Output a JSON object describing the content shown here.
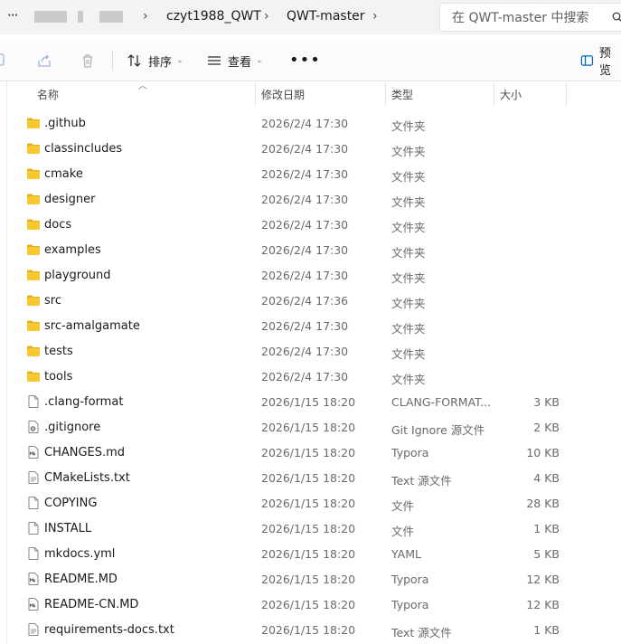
{
  "window": {
    "breadcrumbs": [
      "czyt1988_QWT",
      "QWT-master"
    ],
    "search_placeholder": "在 QWT-master 中搜索"
  },
  "toolbar": {
    "sort_label": "排序",
    "view_label": "查看",
    "more_label": "•••",
    "preview_label": "预览"
  },
  "columns": {
    "name": "名称",
    "modified": "修改日期",
    "type": "类型",
    "size": "大小"
  },
  "files": [
    {
      "name": ".github",
      "modified": "2026/2/4 17:30",
      "type": "文件夹",
      "size": "",
      "icon": "folder-icon"
    },
    {
      "name": "classincludes",
      "modified": "2026/2/4 17:30",
      "type": "文件夹",
      "size": "",
      "icon": "folder-icon"
    },
    {
      "name": "cmake",
      "modified": "2026/2/4 17:30",
      "type": "文件夹",
      "size": "",
      "icon": "folder-icon"
    },
    {
      "name": "designer",
      "modified": "2026/2/4 17:30",
      "type": "文件夹",
      "size": "",
      "icon": "folder-icon"
    },
    {
      "name": "docs",
      "modified": "2026/2/4 17:30",
      "type": "文件夹",
      "size": "",
      "icon": "folder-icon"
    },
    {
      "name": "examples",
      "modified": "2026/2/4 17:30",
      "type": "文件夹",
      "size": "",
      "icon": "folder-icon"
    },
    {
      "name": "playground",
      "modified": "2026/2/4 17:30",
      "type": "文件夹",
      "size": "",
      "icon": "folder-icon"
    },
    {
      "name": "src",
      "modified": "2026/2/4 17:36",
      "type": "文件夹",
      "size": "",
      "icon": "folder-icon"
    },
    {
      "name": "src-amalgamate",
      "modified": "2026/2/4 17:30",
      "type": "文件夹",
      "size": "",
      "icon": "folder-icon"
    },
    {
      "name": "tests",
      "modified": "2026/2/4 17:30",
      "type": "文件夹",
      "size": "",
      "icon": "folder-icon"
    },
    {
      "name": "tools",
      "modified": "2026/2/4 17:30",
      "type": "文件夹",
      "size": "",
      "icon": "folder-icon"
    },
    {
      "name": ".clang-format",
      "modified": "2026/1/15 18:20",
      "type": "CLANG-FORMAT...",
      "size": "3 KB",
      "icon": "file-icon"
    },
    {
      "name": ".gitignore",
      "modified": "2026/1/15 18:20",
      "type": "Git Ignore 源文件",
      "size": "2 KB",
      "icon": "settings-file-icon"
    },
    {
      "name": "CHANGES.md",
      "modified": "2026/1/15 18:20",
      "type": "Typora",
      "size": "10 KB",
      "icon": "markdown-file-icon"
    },
    {
      "name": "CMakeLists.txt",
      "modified": "2026/1/15 18:20",
      "type": "Text 源文件",
      "size": "4 KB",
      "icon": "text-file-icon"
    },
    {
      "name": "COPYING",
      "modified": "2026/1/15 18:20",
      "type": "文件",
      "size": "28 KB",
      "icon": "file-icon"
    },
    {
      "name": "INSTALL",
      "modified": "2026/1/15 18:20",
      "type": "文件",
      "size": "1 KB",
      "icon": "file-icon"
    },
    {
      "name": "mkdocs.yml",
      "modified": "2026/1/15 18:20",
      "type": "YAML",
      "size": "5 KB",
      "icon": "file-icon"
    },
    {
      "name": "README.MD",
      "modified": "2026/1/15 18:20",
      "type": "Typora",
      "size": "12 KB",
      "icon": "markdown-file-icon"
    },
    {
      "name": "README-CN.MD",
      "modified": "2026/1/15 18:20",
      "type": "Typora",
      "size": "12 KB",
      "icon": "markdown-file-icon"
    },
    {
      "name": "requirements-docs.txt",
      "modified": "2026/1/15 18:20",
      "type": "Text 源文件",
      "size": "1 KB",
      "icon": "text-file-icon"
    }
  ],
  "colors": {
    "folder": "#f8c830",
    "folder_tab": "#e8a91c",
    "accent": "#0067c0"
  }
}
